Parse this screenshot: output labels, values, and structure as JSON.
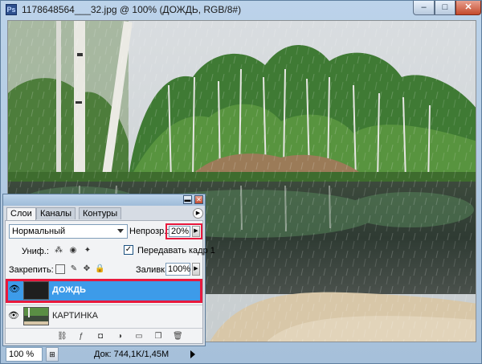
{
  "window": {
    "title": "1178648564___32.jpg @ 100% (ДОЖДЬ, RGB/8#)",
    "doc_icon": "Ps",
    "min_symbol": "–",
    "max_symbol": "□",
    "close_symbol": "✕"
  },
  "status": {
    "zoom": "100 %",
    "doc_info": "Док: 744,1K/1,45M"
  },
  "layers_panel": {
    "tabs": [
      {
        "label": "Слои",
        "active": true
      },
      {
        "label": "Каналы",
        "active": false
      },
      {
        "label": "Контуры",
        "active": false
      }
    ],
    "blend_mode": "Нормальный",
    "opacity_label": "Непрозр.:",
    "opacity_value": "20%",
    "unify_label": "Униф.:",
    "propagate_label": "Передавать кадр 1",
    "propagate_checked": true,
    "lock_label": "Закрепить:",
    "fill_label": "Заливка:",
    "fill_value": "100%",
    "layers": [
      {
        "name": "ДОЖДЬ",
        "selected": true,
        "visible": true
      },
      {
        "name": "КАРТИНКА",
        "selected": false,
        "visible": true
      }
    ]
  },
  "colors": {
    "selection": "#3d9be9",
    "highlight_border": "#e8193d"
  }
}
